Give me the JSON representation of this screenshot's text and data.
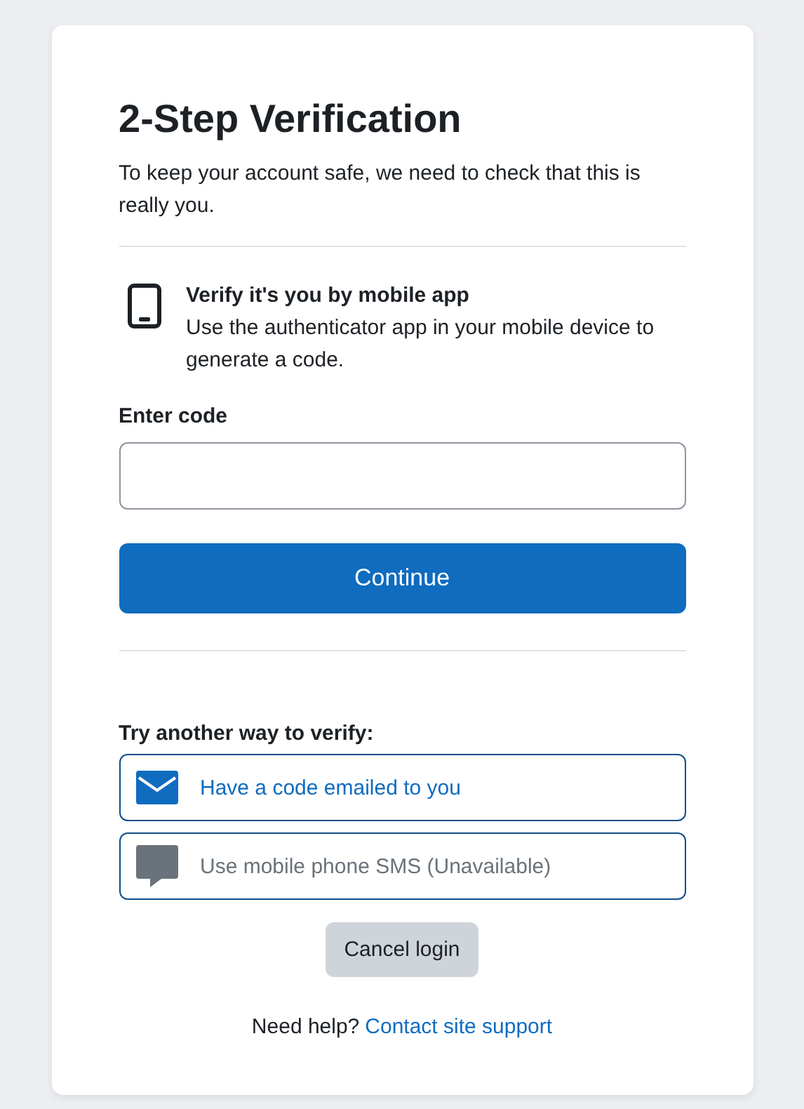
{
  "title": "2-Step Verification",
  "intro": "To keep your account safe, we need to check that this is really you.",
  "method": {
    "title": "Verify it's you by mobile app",
    "description": "Use the authenticator app in your mobile device to generate a code."
  },
  "code_field": {
    "label": "Enter code"
  },
  "continue_button": "Continue",
  "alternatives": {
    "heading": "Try another way to verify:",
    "options": [
      {
        "kind": "email",
        "label": "Have a code emailed to you",
        "disabled": false
      },
      {
        "kind": "sms",
        "label": "Use mobile phone SMS (Unavailable)",
        "disabled": true
      }
    ]
  },
  "cancel_button": "Cancel login",
  "help": {
    "text": "Need help?",
    "link": "Contact site support"
  }
}
